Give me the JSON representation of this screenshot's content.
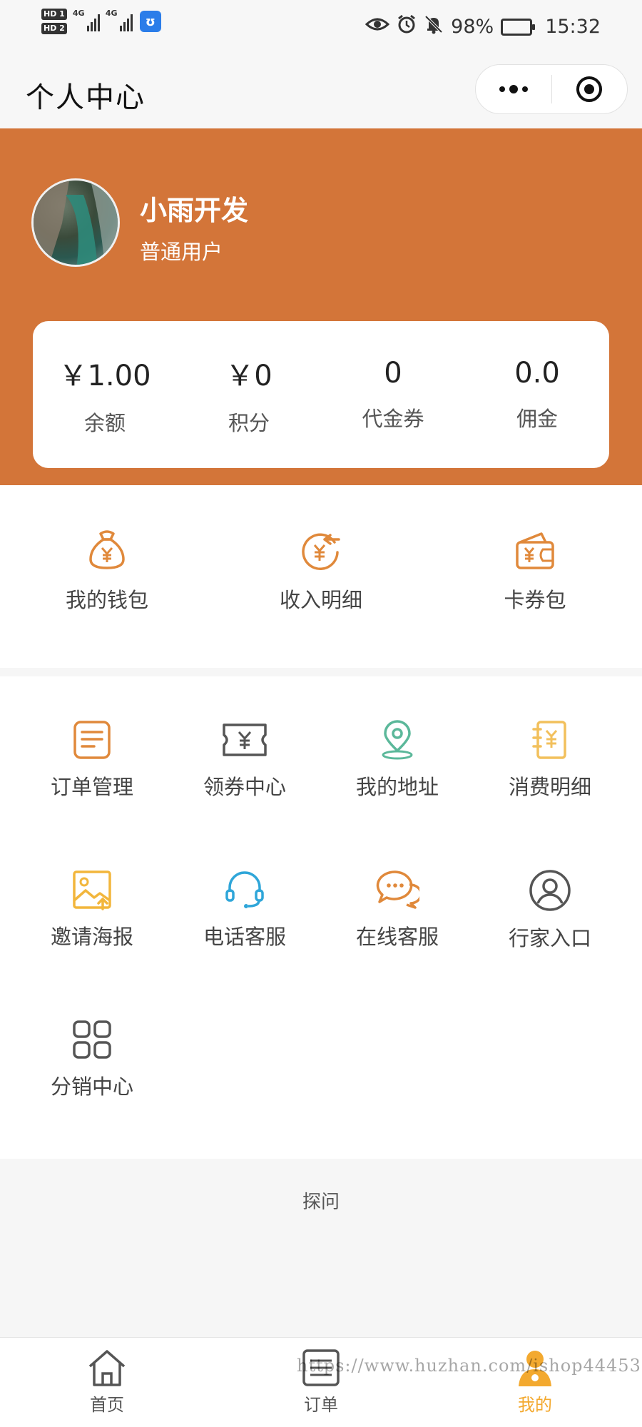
{
  "status_bar": {
    "hd1": "HD 1",
    "hd2": "HD 2",
    "net1": "4G",
    "net2": "4G",
    "battery": "98%",
    "time": "15:32"
  },
  "navbar": {
    "title": "个人中心"
  },
  "profile": {
    "name": "小雨开发",
    "role": "普通用户"
  },
  "stats": [
    {
      "value": "￥1.00",
      "label": "余额"
    },
    {
      "value": "￥0",
      "label": "积分"
    },
    {
      "value": "0",
      "label": "代金券"
    },
    {
      "value": "0.0",
      "label": "佣金"
    }
  ],
  "wallet": [
    {
      "label": "我的钱包",
      "icon": "money-bag-icon"
    },
    {
      "label": "收入明细",
      "icon": "income-icon"
    },
    {
      "label": "卡券包",
      "icon": "card-wallet-icon"
    }
  ],
  "grid": [
    {
      "label": "订单管理",
      "icon": "order-icon"
    },
    {
      "label": "领券中心",
      "icon": "coupon-icon"
    },
    {
      "label": "我的地址",
      "icon": "location-icon"
    },
    {
      "label": "消费明细",
      "icon": "notebook-icon"
    },
    {
      "label": "邀请海报",
      "icon": "poster-icon"
    },
    {
      "label": "电话客服",
      "icon": "headset-icon"
    },
    {
      "label": "在线客服",
      "icon": "chat-icon"
    },
    {
      "label": "行家入口",
      "icon": "user-circle-icon"
    },
    {
      "label": "分销中心",
      "icon": "grid-apps-icon"
    }
  ],
  "footer": {
    "text": "探问"
  },
  "tabbar": [
    {
      "label": "首页",
      "icon": "home-icon"
    },
    {
      "label": "订单",
      "icon": "order-tab-icon"
    },
    {
      "label": "我的",
      "icon": "profile-tab-icon",
      "active": true
    }
  ],
  "watermark": "https://www.huzhan.com/ishop44453",
  "colors": {
    "accent": "#d37539",
    "tab_active": "#f3a92f"
  }
}
